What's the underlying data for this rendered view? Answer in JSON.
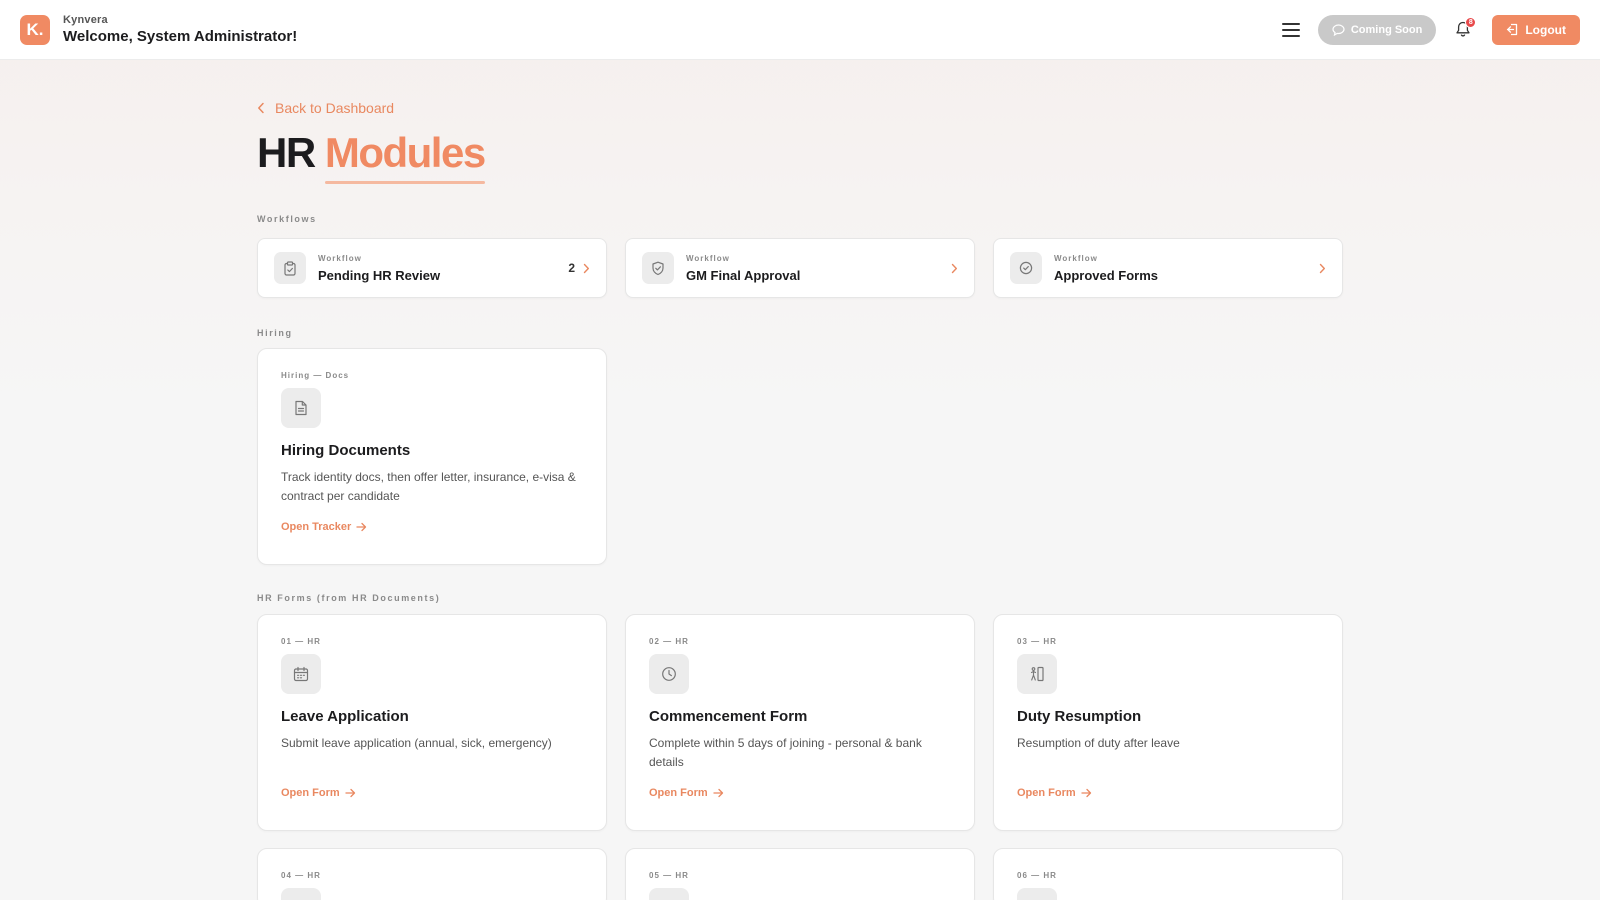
{
  "header": {
    "logo_letter": "K.",
    "brand": "Kynvera",
    "welcome": "Welcome, System Administrator!",
    "coming_soon_label": "Coming Soon",
    "notification_count": "8",
    "logout_label": "Logout"
  },
  "page": {
    "back_label": "Back to Dashboard",
    "title_part1": "HR",
    "title_part2": "Modules"
  },
  "sections": {
    "workflows": "Workflows",
    "hiring": "Hiring",
    "hr_forms": "HR Forms (from HR Documents)"
  },
  "workflows": [
    {
      "kicker": "Workflow",
      "title": "Pending HR Review",
      "count": "2",
      "icon": "clipboard-icon"
    },
    {
      "kicker": "Workflow",
      "title": "GM Final Approval",
      "count": "",
      "icon": "shield-check-icon"
    },
    {
      "kicker": "Workflow",
      "title": "Approved Forms",
      "count": "",
      "icon": "check-circle-icon"
    }
  ],
  "hiring": {
    "kicker": "Hiring — Docs",
    "title": "Hiring Documents",
    "desc": "Track identity docs, then offer letter, insurance, e-visa & contract per candidate",
    "link": "Open Tracker",
    "icon": "document-icon"
  },
  "forms": [
    {
      "kicker": "01 — HR",
      "title": "Leave Application",
      "desc": "Submit leave application (annual, sick, emergency)",
      "link": "Open Form",
      "icon": "calendar-icon"
    },
    {
      "kicker": "02 — HR",
      "title": "Commencement Form",
      "desc": "Complete within 5 days of joining - personal & bank details",
      "link": "Open Form",
      "icon": "clock-icon"
    },
    {
      "kicker": "03 — HR",
      "title": "Duty Resumption",
      "desc": "Resumption of duty after leave",
      "link": "Open Form",
      "icon": "person-door-icon"
    },
    {
      "kicker": "04 — HR"
    },
    {
      "kicker": "05 — HR"
    },
    {
      "kicker": "06 — HR"
    }
  ],
  "colors": {
    "accent": "#f08a63",
    "accent_text": "#e98860",
    "badge": "#e8494b",
    "coming_soon_bg": "#c9c9c9"
  }
}
